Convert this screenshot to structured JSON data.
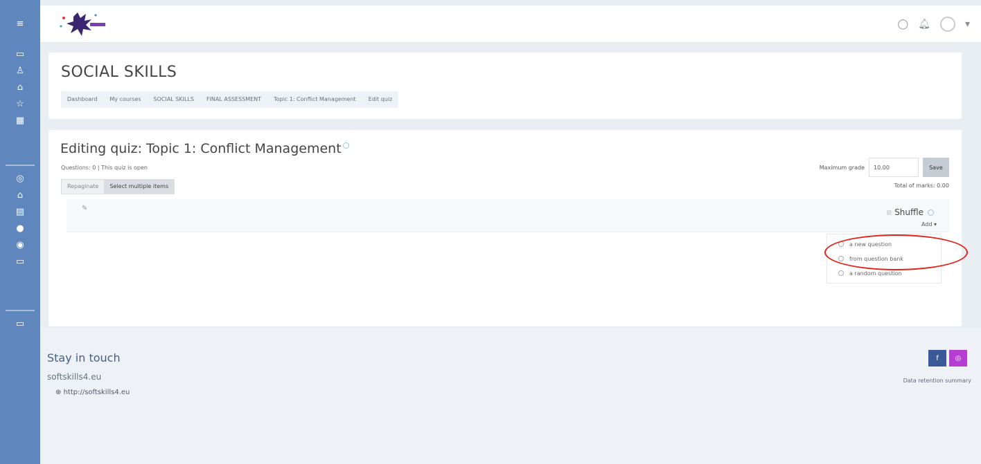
{
  "nav_rail": {
    "icons": [
      "menu-icon",
      "folder-icon",
      "users-icon",
      "lock-icon",
      "star-icon",
      "grid-icon",
      "info-icon",
      "home-icon",
      "calendar-icon",
      "badge-icon",
      "settings-icon",
      "folder-icon",
      "folder-icon"
    ]
  },
  "topbar": {
    "icons": [
      "chat-icon",
      "bell-icon",
      "user-avatar",
      "chevron-down-icon"
    ]
  },
  "header": {
    "title": "SOCIAL SKILLS",
    "breadcrumb": [
      "Dashboard",
      "My courses",
      "SOCIAL SKILLS",
      "FINAL ASSESSMENT",
      "Topic 1: Conflict Management",
      "Edit quiz"
    ]
  },
  "quiz": {
    "title": "Editing quiz: Topic 1: Conflict Management",
    "meta": "Questions: 0 | This quiz is open",
    "tabs": [
      "Repaginate",
      "Select multiple items"
    ],
    "max_grade_label": "Maximum grade",
    "max_grade_value": "10.00",
    "save_label": "Save",
    "total_marks": "Total of marks: 0.00",
    "shuffle_label": "Shuffle",
    "add_label": "Add"
  },
  "add_menu": {
    "items": [
      "a new question",
      "from question bank",
      "a random question"
    ]
  },
  "footer": {
    "title": "Stay in touch",
    "site": "softskills4.eu",
    "link": "http://softskills4.eu",
    "retention": "Data retention summary",
    "social": [
      "f",
      "◎"
    ]
  },
  "colors": {
    "rail": "#5f86bd",
    "highlight": "#e2231a",
    "facebook": "#3b5998",
    "instagram": "#b43fd1"
  }
}
